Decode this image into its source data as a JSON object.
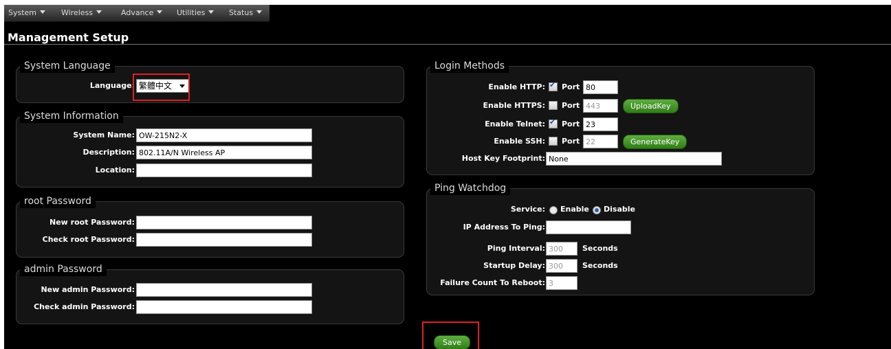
{
  "menu": [
    "System",
    "Wireless",
    "Advance",
    "Utilities",
    "Status"
  ],
  "page_title": "Management Setup",
  "system_language": {
    "legend": "System Language",
    "language_label": "Language:",
    "language_value": "繁體中文"
  },
  "system_information": {
    "legend": "System Information",
    "name_label": "System Name:",
    "name_value": "OW-215N2-X",
    "desc_label": "Description:",
    "desc_value": "802.11A/N Wireless AP",
    "loc_label": "Location:",
    "loc_value": ""
  },
  "root_password": {
    "legend": "root Password",
    "new_label": "New root Password:",
    "check_label": "Check root Password:"
  },
  "admin_password": {
    "legend": "admin Password",
    "new_label": "New admin Password:",
    "check_label": "Check admin Password:"
  },
  "login_methods": {
    "legend": "Login Methods",
    "port_label": "Port :",
    "http": {
      "label": "Enable HTTP:",
      "checked": true,
      "port": "80"
    },
    "https": {
      "label": "Enable HTTPS:",
      "checked": false,
      "port": "443",
      "button": "UploadKey"
    },
    "telnet": {
      "label": "Enable Telnet:",
      "checked": true,
      "port": "23"
    },
    "ssh": {
      "label": "Enable SSH:",
      "checked": false,
      "port": "22",
      "button": "GenerateKey"
    },
    "footprint_label": "Host Key Footprint:",
    "footprint_value": "None"
  },
  "ping_watchdog": {
    "legend": "Ping Watchdog",
    "service_label": "Service:",
    "enable_label": "Enable",
    "disable_label": "Disable",
    "service_value": "Disable",
    "ip_label": "IP Address To Ping:",
    "ip_value": "",
    "interval_label": "Ping Interval:",
    "interval_value": "300",
    "interval_unit": "Seconds",
    "startup_label": "Startup Delay:",
    "startup_value": "300",
    "startup_unit": "Seconds",
    "failure_label": "Failure Count To Reboot:",
    "failure_value": "3"
  },
  "save_label": "Save",
  "colors": {
    "accent_green": "#3f9424",
    "highlight_red": "#e02020",
    "background": "#000000"
  }
}
